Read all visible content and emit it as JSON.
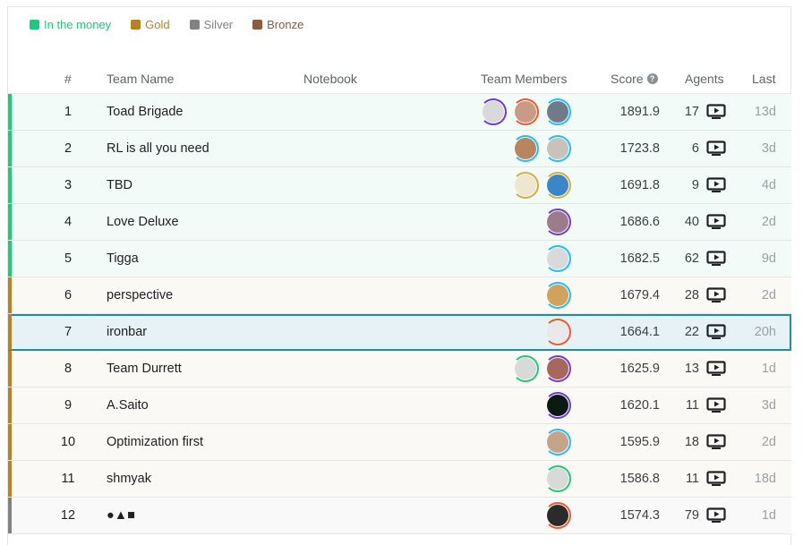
{
  "legend": [
    {
      "label": "In the money",
      "color": "#20beff",
      "swatch": "#1dc97a",
      "text_color": "#1dc97a"
    },
    {
      "label": "Gold",
      "color": "#b88121",
      "swatch": "#b88121",
      "text_color": "#b88121"
    },
    {
      "label": "Silver",
      "color": "#838280",
      "swatch": "#838280",
      "text_color": "#838280"
    },
    {
      "label": "Bronze",
      "color": "#8e5b3d",
      "swatch": "#8e5b3d",
      "text_color": "#8e5b3d"
    }
  ],
  "columns": {
    "rank": "#",
    "team": "Team Name",
    "notebook": "Notebook",
    "members": "Team Members",
    "score": "Score",
    "agents": "Agents",
    "last": "Last"
  },
  "rows": [
    {
      "rank": "1",
      "team": "Toad Brigade",
      "score": "1891.9",
      "agents": "17",
      "last": "13d",
      "tier": "money",
      "members": [
        {
          "ring": "#6c3be0",
          "face": "#d9d9d9"
        },
        {
          "ring": "#f05a28",
          "face": "#c99a86"
        },
        {
          "ring": "#20beff",
          "face": "#707b8a"
        }
      ]
    },
    {
      "rank": "2",
      "team": "RL is all you need",
      "score": "1723.8",
      "agents": "6",
      "last": "3d",
      "tier": "money",
      "members": [
        {
          "ring": "#20beff",
          "face": "#b9855e"
        },
        {
          "ring": "#20beff",
          "face": "#c8c2bb"
        }
      ]
    },
    {
      "rank": "3",
      "team": "TBD",
      "score": "1691.8",
      "agents": "9",
      "last": "4d",
      "tier": "money",
      "members": [
        {
          "ring": "#d4b13a",
          "face": "#efe6cf"
        },
        {
          "ring": "#d4b13a",
          "face": "#3a86c8"
        }
      ]
    },
    {
      "rank": "4",
      "team": "Love Deluxe",
      "score": "1686.6",
      "agents": "40",
      "last": "2d",
      "tier": "money",
      "members": [
        {
          "ring": "#6c3be0",
          "face": "#9d7b8a"
        }
      ]
    },
    {
      "rank": "5",
      "team": "Tigga",
      "score": "1682.5",
      "agents": "62",
      "last": "9d",
      "tier": "money",
      "members": [
        {
          "ring": "#20beff",
          "face": "#d9d9d9"
        }
      ]
    },
    {
      "rank": "6",
      "team": "perspective",
      "score": "1679.4",
      "agents": "28",
      "last": "2d",
      "tier": "gold",
      "members": [
        {
          "ring": "#20beff",
          "face": "#d2a15c"
        }
      ]
    },
    {
      "rank": "7",
      "team": "ironbar",
      "score": "1664.1",
      "agents": "22",
      "last": "20h",
      "tier": "gold",
      "highlight": true,
      "members": [
        {
          "ring": "#f05a28",
          "face": "#e9e9e9"
        }
      ]
    },
    {
      "rank": "8",
      "team": "Team Durrett",
      "score": "1625.9",
      "agents": "13",
      "last": "1d",
      "tier": "gold",
      "members": [
        {
          "ring": "#1dc97a",
          "face": "#d9d9d9"
        },
        {
          "ring": "#6c3be0",
          "face": "#a5685a"
        }
      ]
    },
    {
      "rank": "9",
      "team": "A.Saito",
      "score": "1620.1",
      "agents": "11",
      "last": "3d",
      "tier": "gold",
      "members": [
        {
          "ring": "#6c3be0",
          "face": "#0c1a14"
        }
      ]
    },
    {
      "rank": "10",
      "team": "Optimization first",
      "score": "1595.9",
      "agents": "18",
      "last": "2d",
      "tier": "gold",
      "members": [
        {
          "ring": "#20beff",
          "face": "#c6a48a"
        }
      ]
    },
    {
      "rank": "11",
      "team": "shmyak",
      "score": "1586.8",
      "agents": "11",
      "last": "18d",
      "tier": "gold",
      "members": [
        {
          "ring": "#1dc97a",
          "face": "#d9d9d9"
        }
      ]
    },
    {
      "rank": "12",
      "team": "●▲■",
      "score": "1574.3",
      "agents": "79",
      "last": "1d",
      "tier": "silver",
      "members": [
        {
          "ring": "#f05a28",
          "face": "#2b2b2b"
        }
      ]
    }
  ],
  "tier_colors": {
    "money": {
      "bar": "#1dc97a",
      "bg": "#f3fbf8"
    },
    "gold": {
      "bar": "#b88121",
      "bg": "#fbf9f5"
    },
    "silver": {
      "bar": "#838280",
      "bg": "#f9f9f9"
    },
    "highlight_bg": "#e6f2f6"
  },
  "icons": {
    "help": "question-circle-icon",
    "agents": "tv-play-icon"
  }
}
